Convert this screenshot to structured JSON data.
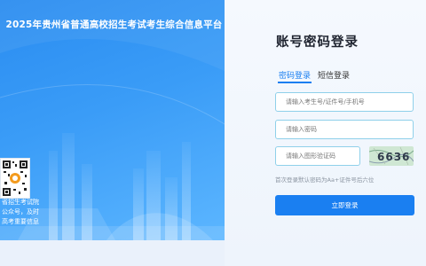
{
  "promo": {
    "title": "2025年贵州省普通高校招生考试考生综合信息平台",
    "caption_lines": [
      "省招生考试院",
      "公众号，及时",
      "高考重要信息"
    ]
  },
  "login": {
    "title": "账号密码登录",
    "tabs": [
      {
        "label": "密码登录",
        "active": true
      },
      {
        "label": "短信登录",
        "active": false
      }
    ],
    "fields": {
      "account_placeholder": "请输入考生号/证件号/手机号",
      "password_placeholder": "请输入密码",
      "captcha_placeholder": "请输入图形验证码"
    },
    "captcha_text": "6636",
    "hint": "首次登录默认密码为Aa+证件号后六位",
    "submit_label": "立即登录"
  },
  "colors": {
    "accent": "#1a7ff1",
    "promo_blue": "#3a9cf7"
  },
  "icons": [
    "qr-code-icon"
  ]
}
